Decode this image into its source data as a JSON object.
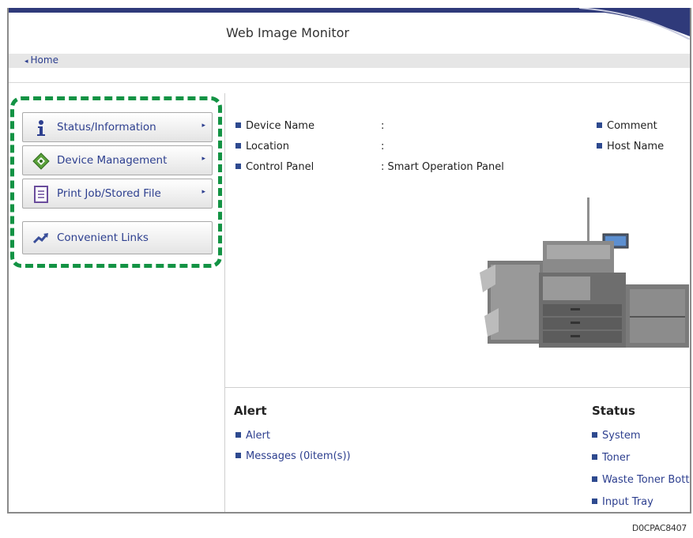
{
  "app": {
    "title": "Web Image Monitor"
  },
  "breadcrumb": {
    "home_label": "Home"
  },
  "menu": {
    "items": [
      {
        "label": "Status/Information",
        "icon": "info-icon"
      },
      {
        "label": "Device Management",
        "icon": "device-management-icon"
      },
      {
        "label": "Print Job/Stored File",
        "icon": "document-icon"
      },
      {
        "label": "Convenient Links",
        "icon": "link-arrow-icon"
      }
    ],
    "highlight_color": "#139344"
  },
  "device_info": {
    "rows": [
      {
        "label": "Device Name",
        "value": ":"
      },
      {
        "label": "Location",
        "value": ":"
      },
      {
        "label": "Control Panel",
        "value": ": Smart Operation Panel"
      }
    ],
    "right_links": [
      "Comment",
      "Host Name"
    ]
  },
  "alert": {
    "title": "Alert",
    "links": [
      "Alert",
      "Messages (0item(s))"
    ]
  },
  "status": {
    "title": "Status",
    "links": [
      "System",
      "Toner",
      "Waste Toner Bottle",
      "Input Tray"
    ]
  },
  "footer": {
    "code": "D0CPAC8407"
  },
  "colors": {
    "accent": "#2d3f8f",
    "header_bar": "#2f3a7a"
  }
}
